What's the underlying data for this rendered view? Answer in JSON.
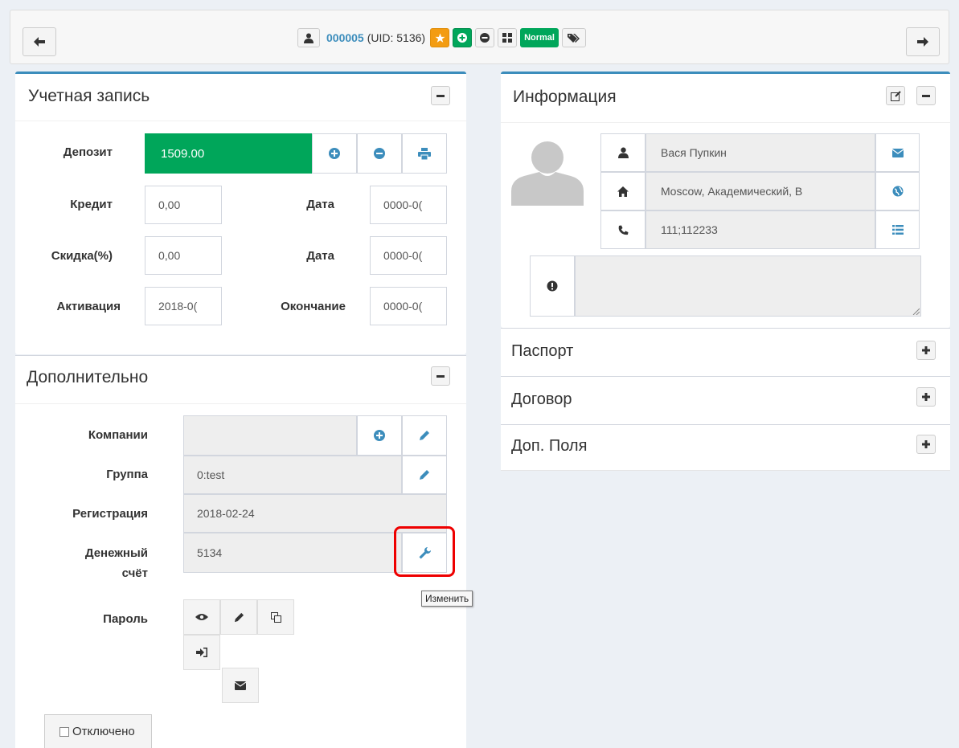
{
  "header": {
    "login": "000005",
    "uid_text": "(UID: 5136)",
    "status_badge": "Normal"
  },
  "account": {
    "title": "Учетная запись",
    "deposit_label": "Депозит",
    "deposit_value": "1509.00",
    "credit_label": "Кредит",
    "credit_value": "0,00",
    "credit_date_label": "Дата",
    "credit_date_value": "0000-0(",
    "discount_label": "Скидка(%)",
    "discount_value": "0,00",
    "discount_date_label": "Дата",
    "discount_date_value": "0000-0(",
    "activation_label": "Активация",
    "activation_value": "2018-0(",
    "expire_label": "Окончание",
    "expire_value": "0000-0("
  },
  "extra": {
    "title": "Дополнительно",
    "company_label": "Компании",
    "company_value": "",
    "group_label": "Группа",
    "group_value": "0:test",
    "registration_label": "Регистрация",
    "registration_value": "2018-02-24",
    "bill_label_line1": "Денежный",
    "bill_label_line2": "счёт",
    "bill_value": "5134",
    "tooltip": "Изменить",
    "password_label": "Пароль",
    "disabled_label": "Отключено"
  },
  "info": {
    "title": "Информация",
    "name": "Вася Пупкин",
    "address": "Moscow, Академический, В",
    "phone": "111;112233",
    "comment": "",
    "sections": [
      "Паспорт",
      "Договор",
      "Доп. Поля"
    ]
  },
  "colors": {
    "primary": "#3c8dbc",
    "success": "#00a65a",
    "warning": "#f39c12",
    "highlight": "#e00000"
  }
}
